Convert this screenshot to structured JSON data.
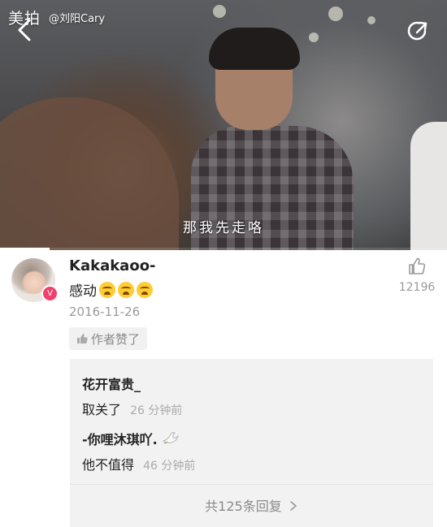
{
  "video": {
    "brand_logo": "美拍",
    "watermark": "@刘阳Cary",
    "subtitle": "那我先走咯",
    "progress": 0.11,
    "icons": {
      "back": "chevron-left-icon",
      "share": "share-icon"
    }
  },
  "comment": {
    "username": "Kakakaoo-",
    "text": "感动",
    "emoji": [
      "loudly-crying-emoji",
      "loudly-crying-emoji",
      "loudly-crying-emoji"
    ],
    "date": "2016-11-26",
    "author_liked": "作者赞了",
    "like_count": "12196",
    "verified_badge_color": "#f0406f"
  },
  "replies": {
    "items": [
      {
        "user": "花开富贵_",
        "text": "取关了",
        "time": "26 分钟前"
      },
      {
        "user": "-你哩沐琪吖.",
        "text": "他不值得",
        "time": "46 分钟前"
      }
    ],
    "more_label": "共125条回复"
  }
}
